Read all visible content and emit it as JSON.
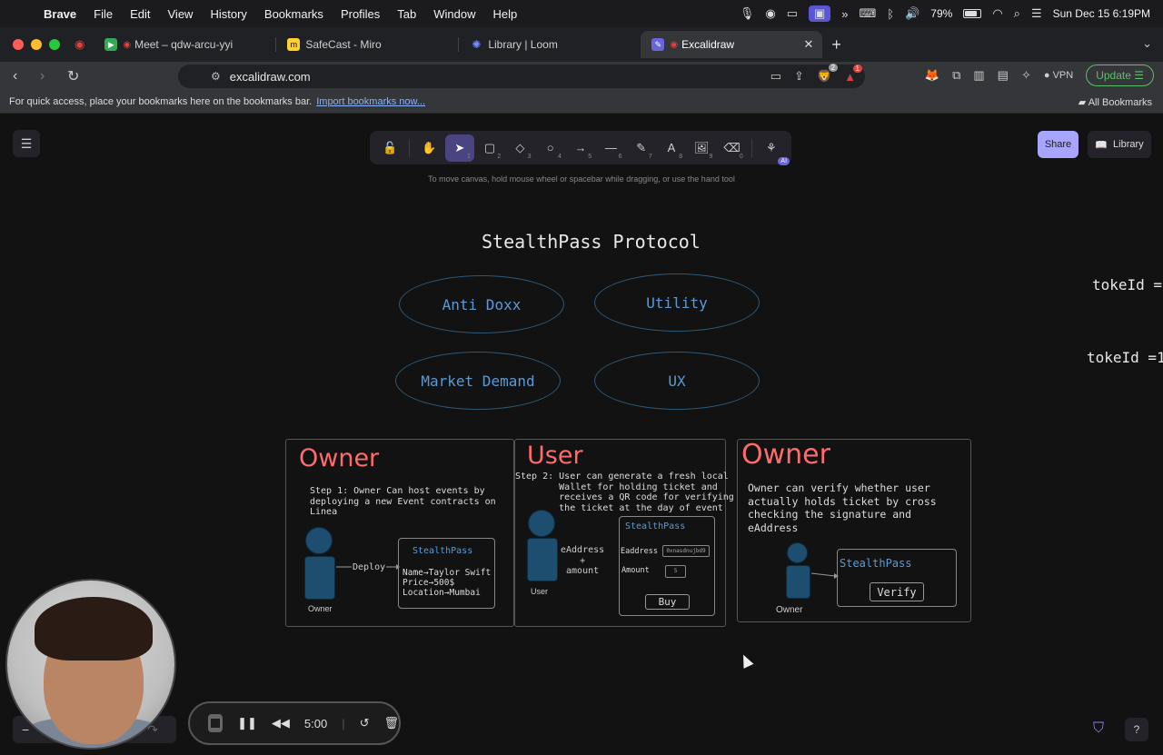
{
  "menubar": {
    "app": "Brave",
    "items": [
      "File",
      "Edit",
      "View",
      "History",
      "Bookmarks",
      "Profiles",
      "Tab",
      "Window",
      "Help"
    ],
    "battery": "79%",
    "datetime": "Sun Dec 15  6:19PM"
  },
  "tabs": [
    {
      "title": "Meet – qdw-arcu-yyi"
    },
    {
      "title": "SafeCast - Miro"
    },
    {
      "title": "Library | Loom"
    },
    {
      "title": "Excalidraw"
    }
  ],
  "address": {
    "url": "excalidraw.com",
    "brave_badge": "2",
    "alert_badge": "1",
    "vpn": "VPN",
    "update": "Update"
  },
  "bookmarks": {
    "hint": "For quick access, place your bookmarks here on the bookmarks bar.",
    "import_link": "Import bookmarks now...",
    "all": "All Bookmarks"
  },
  "excalidraw": {
    "tool_numbers": [
      "1",
      "2",
      "3",
      "4",
      "5",
      "6",
      "7",
      "8",
      "9",
      "0"
    ],
    "ai_badge": "AI",
    "hint": "To move canvas, hold mouse wheel or spacebar while dragging, or use the hand tool",
    "share": "Share",
    "library": "Library"
  },
  "diagram": {
    "title": "StealthPass Protocol",
    "ellipses": [
      "Anti Doxx",
      "Utility",
      "Market Demand",
      "UX"
    ],
    "side_texts": [
      "tokeId =",
      "tokeId =1"
    ],
    "panel1": {
      "heading": "Owner",
      "step": "Step 1: Owner Can host events by\ndeploying a new Event contracts on\nLinea",
      "person": "Owner",
      "arrow": "Deploy",
      "box_title": "StealthPass",
      "box_lines": "Name→Taylor Swift\nPrice→500$\nLocation→Mumbai"
    },
    "panel2": {
      "heading": "User",
      "step": "Step 2: User can generate a fresh local\n        Wallet for holding ticket and\n        receives a QR code for verifying\n        the ticket at the day of event",
      "person": "User",
      "arrow": "eAddress\n+\namount",
      "box_title": "StealthPass",
      "field1_label": "Eaddress",
      "field1_value": "0xnasdnujbd9",
      "field2_label": "Amount",
      "field2_value": "5",
      "button": "Buy"
    },
    "panel3": {
      "heading": "Owner",
      "text": "Owner can verify whether user\nactually holds ticket by cross\nchecking the signature and\neAddress",
      "person": "Owner",
      "box_title": "StealthPass",
      "button": "Verify"
    }
  },
  "loom": {
    "timer": "5:00"
  }
}
